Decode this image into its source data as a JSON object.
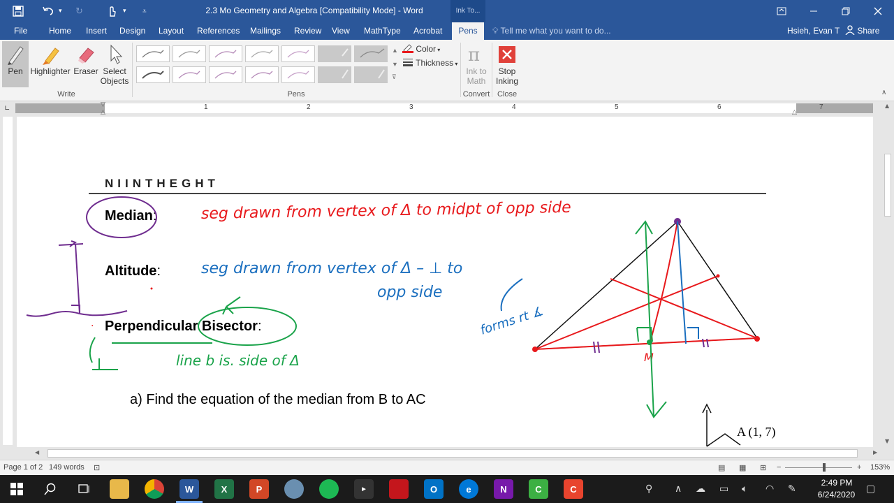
{
  "window": {
    "doc_title": "2.3 Mo Geometry and Algebra [Compatibility Mode] - Word",
    "ink_tools_label": "Ink To..."
  },
  "tabs": [
    {
      "label": "File"
    },
    {
      "label": "Home"
    },
    {
      "label": "Insert"
    },
    {
      "label": "Design"
    },
    {
      "label": "Layout"
    },
    {
      "label": "References"
    },
    {
      "label": "Mailings"
    },
    {
      "label": "Review"
    },
    {
      "label": "View"
    },
    {
      "label": "MathType"
    },
    {
      "label": "Acrobat"
    },
    {
      "label": "Pens"
    }
  ],
  "tell_me": "Tell me what you want to do...",
  "user": "Hsieh, Evan T",
  "share": "Share",
  "ribbon": {
    "write": {
      "pen": "Pen",
      "highlighter": "Highlighter",
      "eraser": "Eraser",
      "select_line1": "Select",
      "select_line2": "Objects",
      "group": "Write"
    },
    "pens_group": "Pens",
    "color": "Color",
    "thickness": "Thickness",
    "ink_to_math_line1": "Ink to",
    "ink_to_math_line2": "Math",
    "convert_group": "Convert",
    "stop_line1": "Stop",
    "stop_line2": "Inking",
    "close_group": "Close"
  },
  "ruler_numbers": [
    "1",
    "2",
    "3",
    "4",
    "5",
    "6",
    "7"
  ],
  "document": {
    "heading": "NIINTHEGHT",
    "median_label": "Median",
    "altitude_label": "Altitude",
    "perp_bold": "Perpendicular Bisector",
    "question_a": "a)    Find the equation of the median from B to AC",
    "coord_a": "A (1, 7)"
  },
  "ink": {
    "median_def": "seg drawn from vertex of Δ to midpt of opp side",
    "altitude_def": "seg drawn from vertex of Δ – ⊥ to",
    "altitude_def2": "opp side",
    "forms_rt": "forms rt ∡",
    "perp_def": "line b is. side of Δ",
    "m_label": "M",
    "colors": {
      "red": "#e8191c",
      "blue": "#1b6fbf",
      "green": "#1aa34a",
      "purple": "#6f2d8f",
      "black": "#111111"
    }
  },
  "status": {
    "page": "Page 1 of 2",
    "words": "149 words",
    "zoom": "153%"
  },
  "taskbar": {
    "time": "2:49 PM",
    "date": "6/24/2020"
  }
}
